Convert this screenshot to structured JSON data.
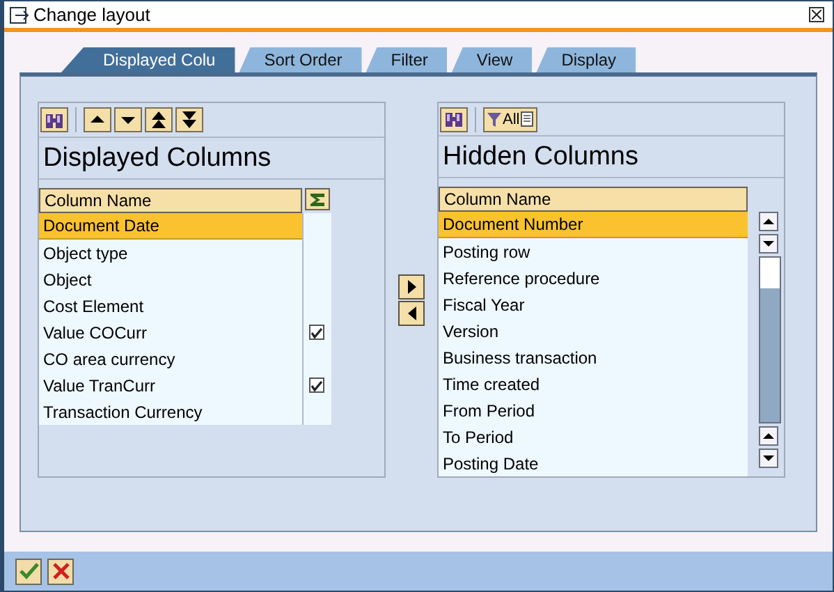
{
  "window": {
    "title": "Change layout"
  },
  "tabs": [
    {
      "label": "Displayed Colu",
      "selected": true
    },
    {
      "label": "Sort Order",
      "selected": false
    },
    {
      "label": "Filter",
      "selected": false
    },
    {
      "label": "View",
      "selected": false
    },
    {
      "label": "Display",
      "selected": false
    }
  ],
  "displayed_columns": {
    "title": "Displayed Columns",
    "column_header": "Column Name",
    "rows": [
      {
        "name": "Document Date",
        "selected": true,
        "checked": false
      },
      {
        "name": "Object type",
        "selected": false,
        "checked": false
      },
      {
        "name": "Object",
        "selected": false,
        "checked": false
      },
      {
        "name": "Cost Element",
        "selected": false,
        "checked": false
      },
      {
        "name": "Value COCurr",
        "selected": false,
        "checked": true
      },
      {
        "name": "CO area currency",
        "selected": false,
        "checked": false
      },
      {
        "name": "Value TranCurr",
        "selected": false,
        "checked": true
      },
      {
        "name": "Transaction Currency",
        "selected": false,
        "checked": false
      }
    ]
  },
  "hidden_columns": {
    "title": "Hidden Columns",
    "filter_label": "All",
    "column_header": "Column Name",
    "rows": [
      {
        "name": "Document Number",
        "selected": true
      },
      {
        "name": "Posting row",
        "selected": false
      },
      {
        "name": "Reference procedure",
        "selected": false
      },
      {
        "name": "Fiscal Year",
        "selected": false
      },
      {
        "name": "Version",
        "selected": false
      },
      {
        "name": "Business transaction",
        "selected": false
      },
      {
        "name": "Time created",
        "selected": false
      },
      {
        "name": "From Period",
        "selected": false
      },
      {
        "name": "To Period",
        "selected": false
      },
      {
        "name": "Posting Date",
        "selected": false
      }
    ]
  }
}
